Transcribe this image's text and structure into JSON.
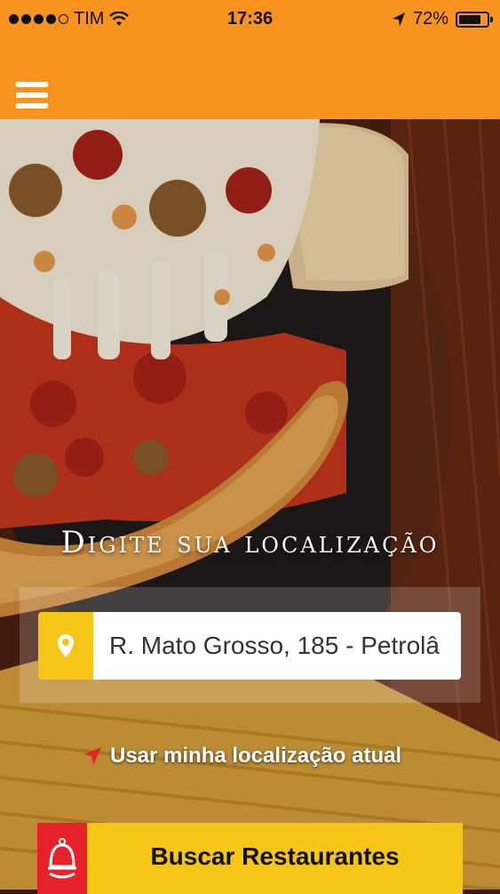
{
  "status_bar": {
    "carrier": "TIM",
    "time": "17:36",
    "battery_percent": "72%",
    "battery_level": 0.72,
    "signal_bars_filled": 4,
    "signal_bars_total": 5
  },
  "header": {
    "menu_icon": "hamburger-menu-icon",
    "bar_color": "#f7931e"
  },
  "main": {
    "title": "Digite sua localização",
    "address_value": "R. Mato Grosso, 185 - Petrolâ",
    "pin_icon": "map-pin-icon",
    "use_location_label": "Usar minha localização atual",
    "use_location_icon": "navigation-arrow-icon",
    "search_button_label": "Buscar Restaurantes",
    "search_button_icon": "service-bell-icon",
    "accent_yellow": "#f5c518",
    "accent_red": "#e8222a"
  }
}
